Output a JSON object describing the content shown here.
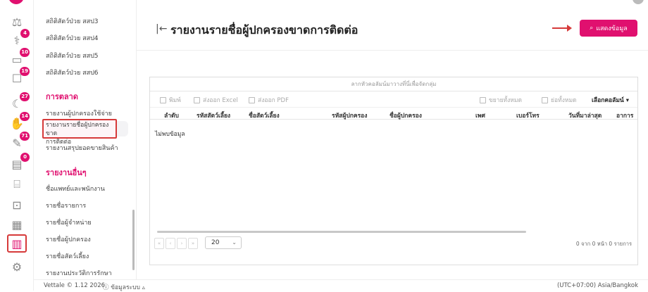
{
  "page": {
    "title": "รายงานรายชื่อผู้ปกครองขาดการติดต่อ",
    "show_button": "แสดงข้อมูล"
  },
  "rail": {
    "items": [
      {
        "icon": "scale-icon",
        "badge": ""
      },
      {
        "icon": "stethoscope-icon",
        "badge": "4"
      },
      {
        "icon": "bed-icon",
        "badge": "10"
      },
      {
        "icon": "box-icon",
        "badge": "19"
      },
      {
        "icon": "moon-icon",
        "badge": "27"
      },
      {
        "icon": "hand-icon",
        "badge": "14"
      },
      {
        "icon": "syringe-icon",
        "badge": "71"
      },
      {
        "icon": "clipboard-icon",
        "badge": "0"
      },
      {
        "icon": "register-icon",
        "badge": ""
      },
      {
        "icon": "bag-icon",
        "badge": ""
      },
      {
        "icon": "grid-icon",
        "badge": ""
      },
      {
        "icon": "chart-icon",
        "badge": ""
      },
      {
        "icon": "gear-icon",
        "badge": ""
      }
    ]
  },
  "menu": {
    "stats": [
      "สถิติสัตว์ป่วย สสป3",
      "สถิติสัตว์ป่วย สสป4",
      "สถิติสัตว์ป่วย สสป5",
      "สถิติสัตว์ป่วย สสป6"
    ],
    "marketing_head": "การตลาด",
    "marketing": [
      "รายงานผู้ปกครองใช้จ่าย",
      "รายงานรายชื่อผู้ปกครองขาด",
      "การติดต่อ",
      "รายงานสรุปยอดขายสินค้า"
    ],
    "other_head": "รายงานอื่นๆ",
    "other": [
      "ชื่อแพทย์และพนักงาน",
      "รายชื่อรายการ",
      "รายชื่อผู้จำหน่าย",
      "รายชื่อผู้ปกครอง",
      "รายชื่อสัตว์เลี้ยง",
      "รายงานประวัติการรักษา"
    ]
  },
  "grid": {
    "group_hint": "ลากหัวคอลัมน์มาวางที่นี่เพื่อจัดกลุ่ม",
    "toolbar": {
      "print": "พิมพ์",
      "export_excel": "ส่งออก Excel",
      "export_pdf": "ส่งออก PDF",
      "expand_all": "ขยายทั้งหมด",
      "collapse_all": "ย่อทั้งหมด",
      "choose_columns": "เลือกคอลัมน์"
    },
    "columns": [
      "ลำดับ",
      "รหัสสัตว์เลี้ยง",
      "ชื่อสัตว์เลี้ยง",
      "รหัสผู้ปกครอง",
      "ชื่อผู้ปกครอง",
      "เพศ",
      "เบอร์โทร",
      "วันที่มาล่าสุด",
      "อาการ"
    ],
    "empty_text": "ไม่พบข้อมูล",
    "page_size": "20",
    "page_info": "0 จาก 0 หน้า 0 รายการ"
  },
  "footer": {
    "version": "Vettale © 1.12 2026",
    "system": "ข้อมูลระบบ",
    "timezone": "(UTC+07:00) Asia/Bangkok"
  },
  "colors": {
    "accent": "#e0106f",
    "highlight": "#d63a3a"
  }
}
